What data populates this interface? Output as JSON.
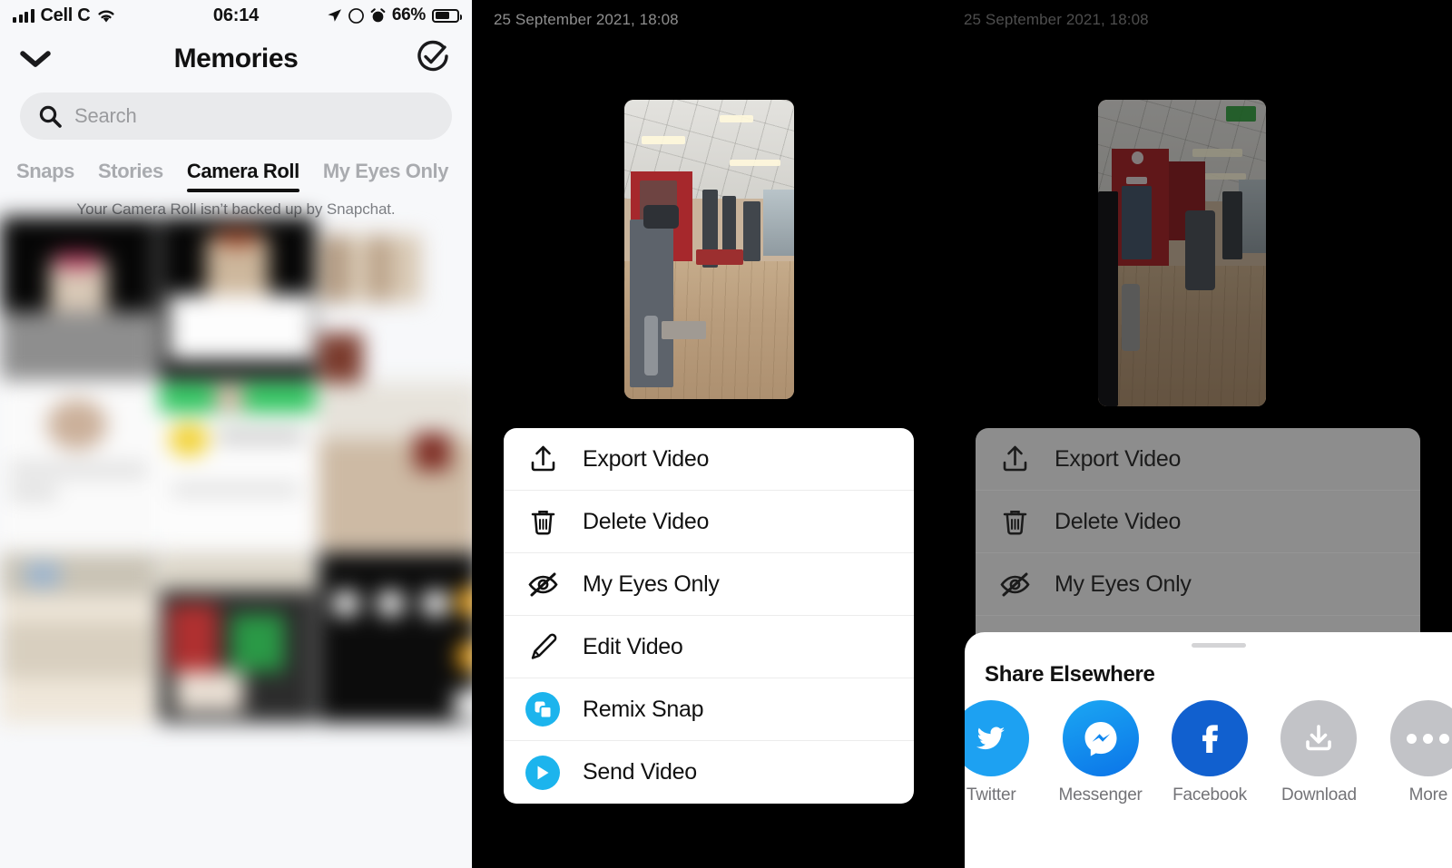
{
  "panel1": {
    "statusbar": {
      "carrier": "Cell C",
      "time": "06:14",
      "battery_percent": "66%",
      "icons": [
        "signal-bars-icon",
        "wifi-icon",
        "location-arrow-icon",
        "do-not-disturb-icon",
        "alarm-clock-icon",
        "battery-icon"
      ]
    },
    "navbar": {
      "title": "Memories",
      "back_icon": "chevron-down-icon",
      "select_icon": "check-circle-icon"
    },
    "search": {
      "placeholder": "Search",
      "icon": "search-icon"
    },
    "tabs": [
      {
        "label": "Snaps",
        "active": false
      },
      {
        "label": "Stories",
        "active": false
      },
      {
        "label": "Camera Roll",
        "active": true
      },
      {
        "label": "My Eyes Only",
        "active": false
      }
    ],
    "backup_note": "Your Camera Roll isn’t backed up by Snapchat."
  },
  "panel2": {
    "date": "25 September 2021, 18:08",
    "menu": [
      {
        "label": "Export Video",
        "icon": "export-upload-icon",
        "style": "plain"
      },
      {
        "label": "Delete Video",
        "icon": "trash-icon",
        "style": "plain"
      },
      {
        "label": "My Eyes Only",
        "icon": "eye-slash-icon",
        "style": "plain"
      },
      {
        "label": "Edit Video",
        "icon": "pencil-icon",
        "style": "plain"
      },
      {
        "label": "Remix Snap",
        "icon": "remix-copy-icon",
        "style": "blue-circle"
      },
      {
        "label": "Send Video",
        "icon": "send-arrow-icon",
        "style": "blue-circle"
      }
    ]
  },
  "panel3": {
    "date": "25 September 2021, 18:08",
    "menu": [
      {
        "label": "Export Video",
        "icon": "export-upload-icon"
      },
      {
        "label": "Delete Video",
        "icon": "trash-icon"
      },
      {
        "label": "My Eyes Only",
        "icon": "eye-slash-icon"
      }
    ],
    "share_sheet": {
      "title": "Share Elsewhere",
      "grabber": "sheet-drag-handle",
      "items": [
        {
          "label": "Twitter",
          "icon": "twitter-bird-icon",
          "color": "#1da1f2"
        },
        {
          "label": "Messenger",
          "icon": "messenger-bolt-icon",
          "color": "#1292ff"
        },
        {
          "label": "Facebook",
          "icon": "facebook-f-icon",
          "color": "#1160cf"
        },
        {
          "label": "Download",
          "icon": "download-arrow-icon",
          "color": "#c2c3c7"
        },
        {
          "label": "More",
          "icon": "ellipsis-icon",
          "color": "#c2c3c7"
        }
      ]
    }
  },
  "colors": {
    "accent_blue": "#1cb4ed",
    "bg_light": "#f7f8fa",
    "bg_dark": "#000000",
    "text_dark": "#111111",
    "text_muted": "#a9abaf"
  }
}
